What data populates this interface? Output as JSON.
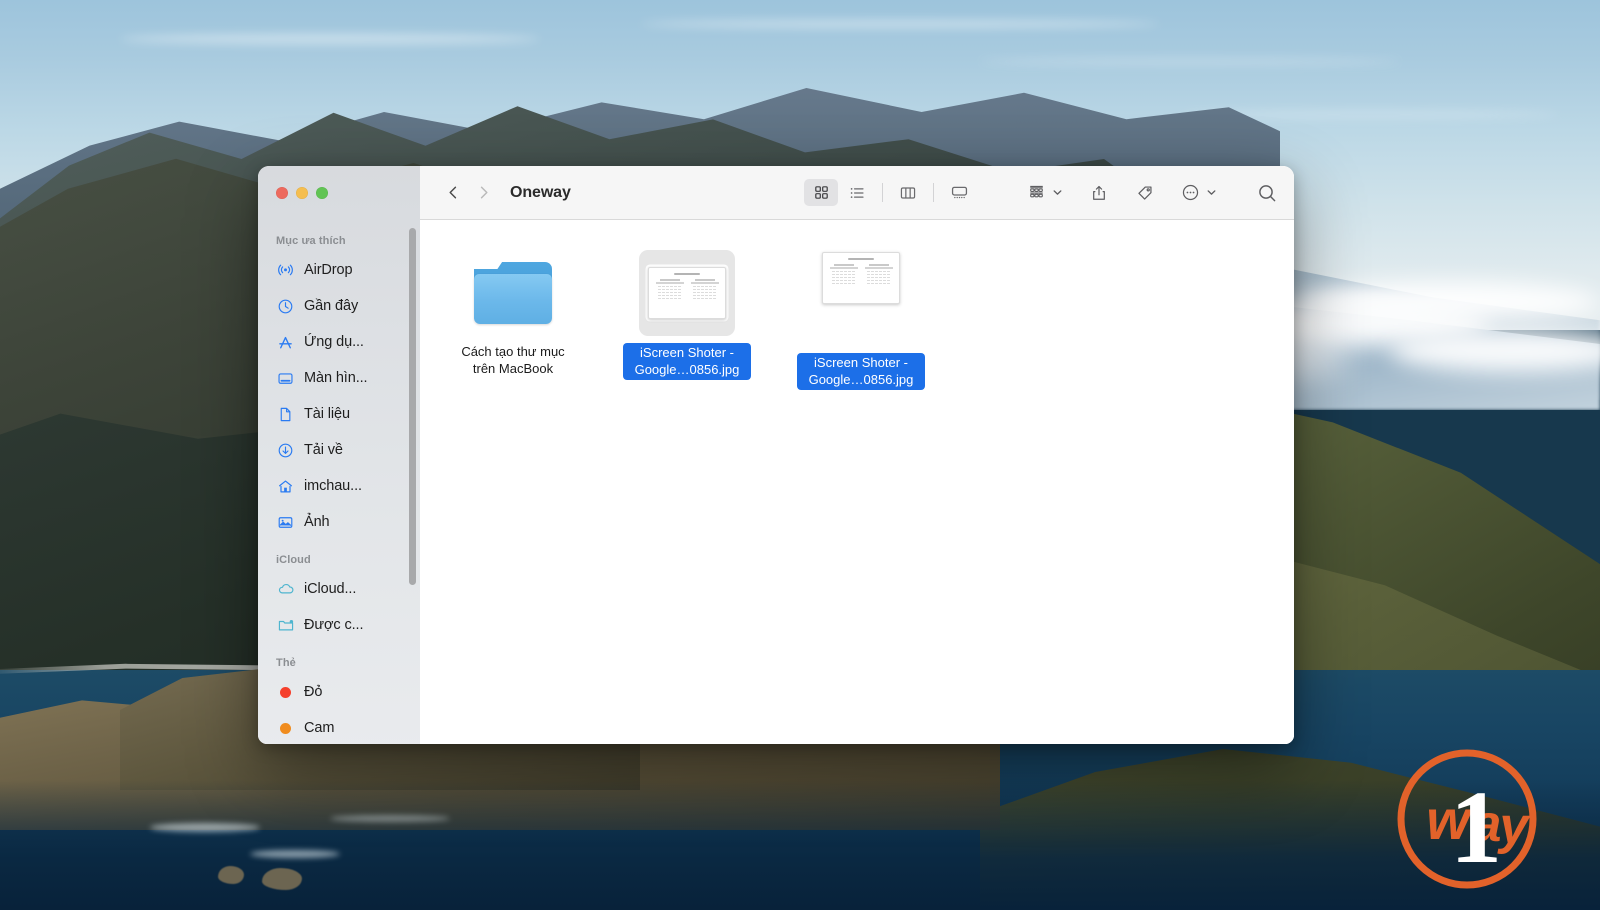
{
  "desktop": {
    "wallpaper_name": "big-sur-coastline",
    "colors": {
      "sky_top": "#9dc4dc",
      "sky_bottom": "#e8eef0",
      "ocean": "#133c5a",
      "ridge_dark": "#2b3129"
    }
  },
  "window": {
    "title": "Oneway",
    "traffic_lights": [
      {
        "name": "close",
        "color": "#ED6A5E"
      },
      {
        "name": "minimize",
        "color": "#F5BE4F"
      },
      {
        "name": "zoom",
        "color": "#61C454"
      }
    ]
  },
  "toolbar": {
    "back_label": "Back",
    "forward_label": "Forward",
    "view_buttons": [
      {
        "name": "icon-view",
        "label": "Icon View",
        "active": true
      },
      {
        "name": "list-view",
        "label": "List View",
        "active": false
      },
      {
        "name": "column-view",
        "label": "Column View",
        "active": false
      },
      {
        "name": "gallery-view",
        "label": "Gallery View",
        "active": false
      }
    ],
    "group_label": "Group",
    "share_label": "Share",
    "tags_label": "Tags",
    "more_label": "More",
    "search_label": "Search"
  },
  "sidebar": {
    "sections": [
      {
        "heading": "Mục ưa thích",
        "items": [
          {
            "icon": "airdrop-icon",
            "label": "AirDrop"
          },
          {
            "icon": "clock-icon",
            "label": "Gần đây"
          },
          {
            "icon": "applications-icon",
            "label": "Ứng dụ..."
          },
          {
            "icon": "desktop-icon",
            "label": "Màn hìn..."
          },
          {
            "icon": "document-icon",
            "label": "Tài liệu"
          },
          {
            "icon": "downloads-icon",
            "label": "Tải về"
          },
          {
            "icon": "home-icon",
            "label": "imchau..."
          },
          {
            "icon": "photos-icon",
            "label": "Ảnh"
          }
        ]
      },
      {
        "heading": "iCloud",
        "items": [
          {
            "icon": "cloud-icon",
            "label": "iCloud..."
          },
          {
            "icon": "shared-folder-icon",
            "label": "Được c..."
          }
        ]
      },
      {
        "heading": "Thẻ",
        "items": [
          {
            "icon": "tag-dot-icon",
            "label": "Đỏ",
            "color": "#F5402C"
          },
          {
            "icon": "tag-dot-icon",
            "label": "Cam",
            "color": "#F08C1E"
          }
        ]
      }
    ]
  },
  "content": {
    "items": [
      {
        "name": "Cách tạo thư mục trên MacBook",
        "kind": "folder",
        "selected": false,
        "icon": "folder-icon"
      },
      {
        "name": "iScreen Shoter - Google…0856.jpg",
        "kind": "image",
        "selected": true,
        "focused": true,
        "icon": "image-thumbnail"
      },
      {
        "name": "iScreen Shoter - Google…0856.jpg",
        "kind": "image",
        "selected": true,
        "focused": false,
        "icon": "image-thumbnail"
      }
    ],
    "selection_color": "#1C6FE8"
  },
  "watermark": {
    "brand": "way1",
    "word": "way",
    "digit": "1",
    "color": "#E2622A"
  }
}
